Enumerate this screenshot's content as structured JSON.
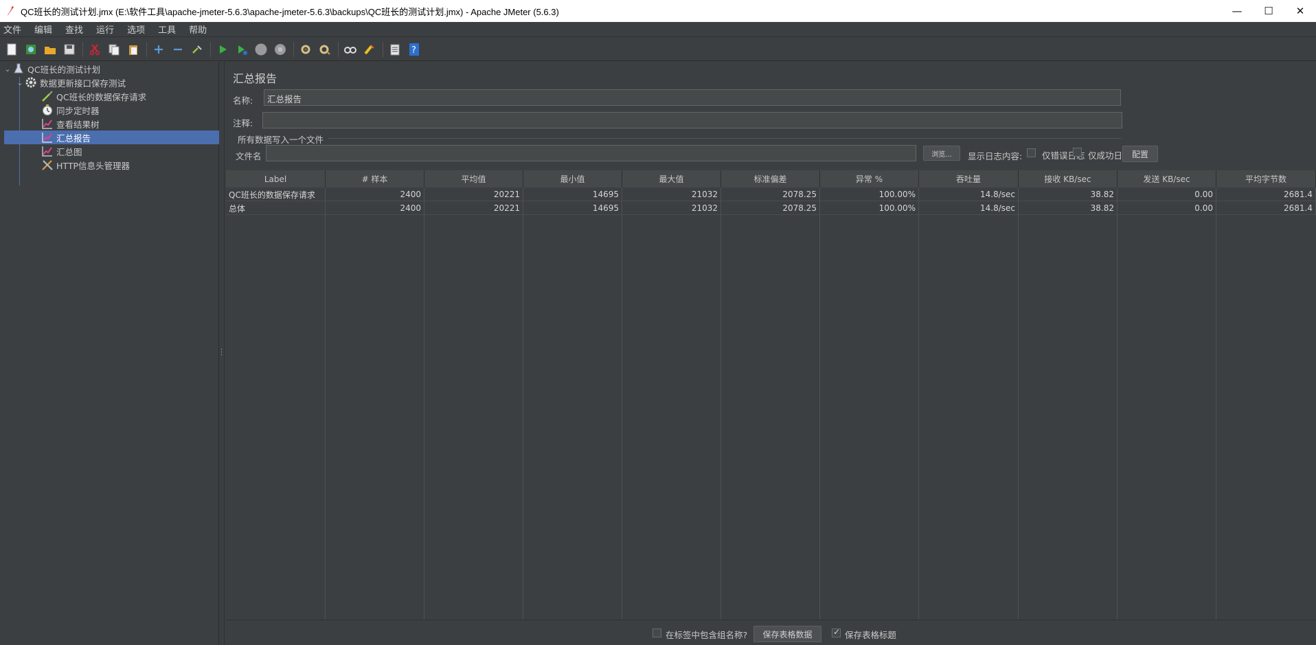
{
  "window": {
    "title": "QC班长的测试计划.jmx (E:\\软件工具\\apache-jmeter-5.6.3\\apache-jmeter-5.6.3\\backups\\QC班长的测试计划.jmx) - Apache JMeter (5.6.3)",
    "minimize": "—",
    "maximize": "☐",
    "close": "✕"
  },
  "menu": [
    "文件",
    "编辑",
    "查找",
    "运行",
    "选项",
    "工具",
    "帮助"
  ],
  "toolbar": {
    "icons": [
      "new-icon",
      "templates-icon",
      "open-icon",
      "save-icon",
      "cut-icon",
      "copy-icon",
      "paste-icon",
      "expand-icon",
      "collapse-icon",
      "toggle-icon",
      "start-icon",
      "start-no-pause-icon",
      "stop-icon",
      "shutdown-icon",
      "clear-icon",
      "clear-all-icon",
      "search-icon",
      "reset-search-icon",
      "function-helper-icon",
      "help-icon"
    ]
  },
  "tree": {
    "items": [
      {
        "label": "QC班长的测试计划",
        "icon": "flask-icon",
        "level": 0
      },
      {
        "label": "数据更新接口保存测试",
        "icon": "gear-icon",
        "level": 1
      },
      {
        "label": "QC班长的数据保存请求",
        "icon": "pipette-icon",
        "level": 2
      },
      {
        "label": "同步定时器",
        "icon": "timer-icon",
        "level": 2
      },
      {
        "label": "查看结果树",
        "icon": "graph-icon",
        "level": 2
      },
      {
        "label": "汇总报告",
        "icon": "graph-icon",
        "level": 2
      },
      {
        "label": "汇总图",
        "icon": "graph-icon",
        "level": 2
      },
      {
        "label": "HTTP信息头管理器",
        "icon": "wrench-icon",
        "level": 2
      }
    ]
  },
  "panel": {
    "title": "汇总报告",
    "name_label": "名称:",
    "name_value": "汇总报告",
    "comment_label": "注释:",
    "comment_value": "",
    "file_group_label": "所有数据写入一个文件",
    "filename_label": "文件名",
    "filename_value": "",
    "browse": "浏览...",
    "log_label": "显示日志内容:",
    "errors_only": "仅错误日志",
    "success_only": "仅成功日志",
    "configure": "配置"
  },
  "table": {
    "columns": [
      "Label",
      "# 样本",
      "平均值",
      "最小值",
      "最大值",
      "标准偏差",
      "异常 %",
      "吞吐量",
      "接收 KB/sec",
      "发送 KB/sec",
      "平均字节数"
    ],
    "rows": [
      [
        "QC班长的数据保存请求",
        "2400",
        "20221",
        "14695",
        "21032",
        "2078.25",
        "100.00%",
        "14.8/sec",
        "38.82",
        "0.00",
        "2681.4"
      ],
      [
        "总体",
        "2400",
        "20221",
        "14695",
        "21032",
        "2078.25",
        "100.00%",
        "14.8/sec",
        "38.82",
        "0.00",
        "2681.4"
      ]
    ]
  },
  "bottom": {
    "include_group_label": "在标签中包含组名称?",
    "save_table_data": "保存表格数据",
    "save_table_header": "保存表格标题",
    "include_group_checked": false,
    "save_header_checked": true
  }
}
